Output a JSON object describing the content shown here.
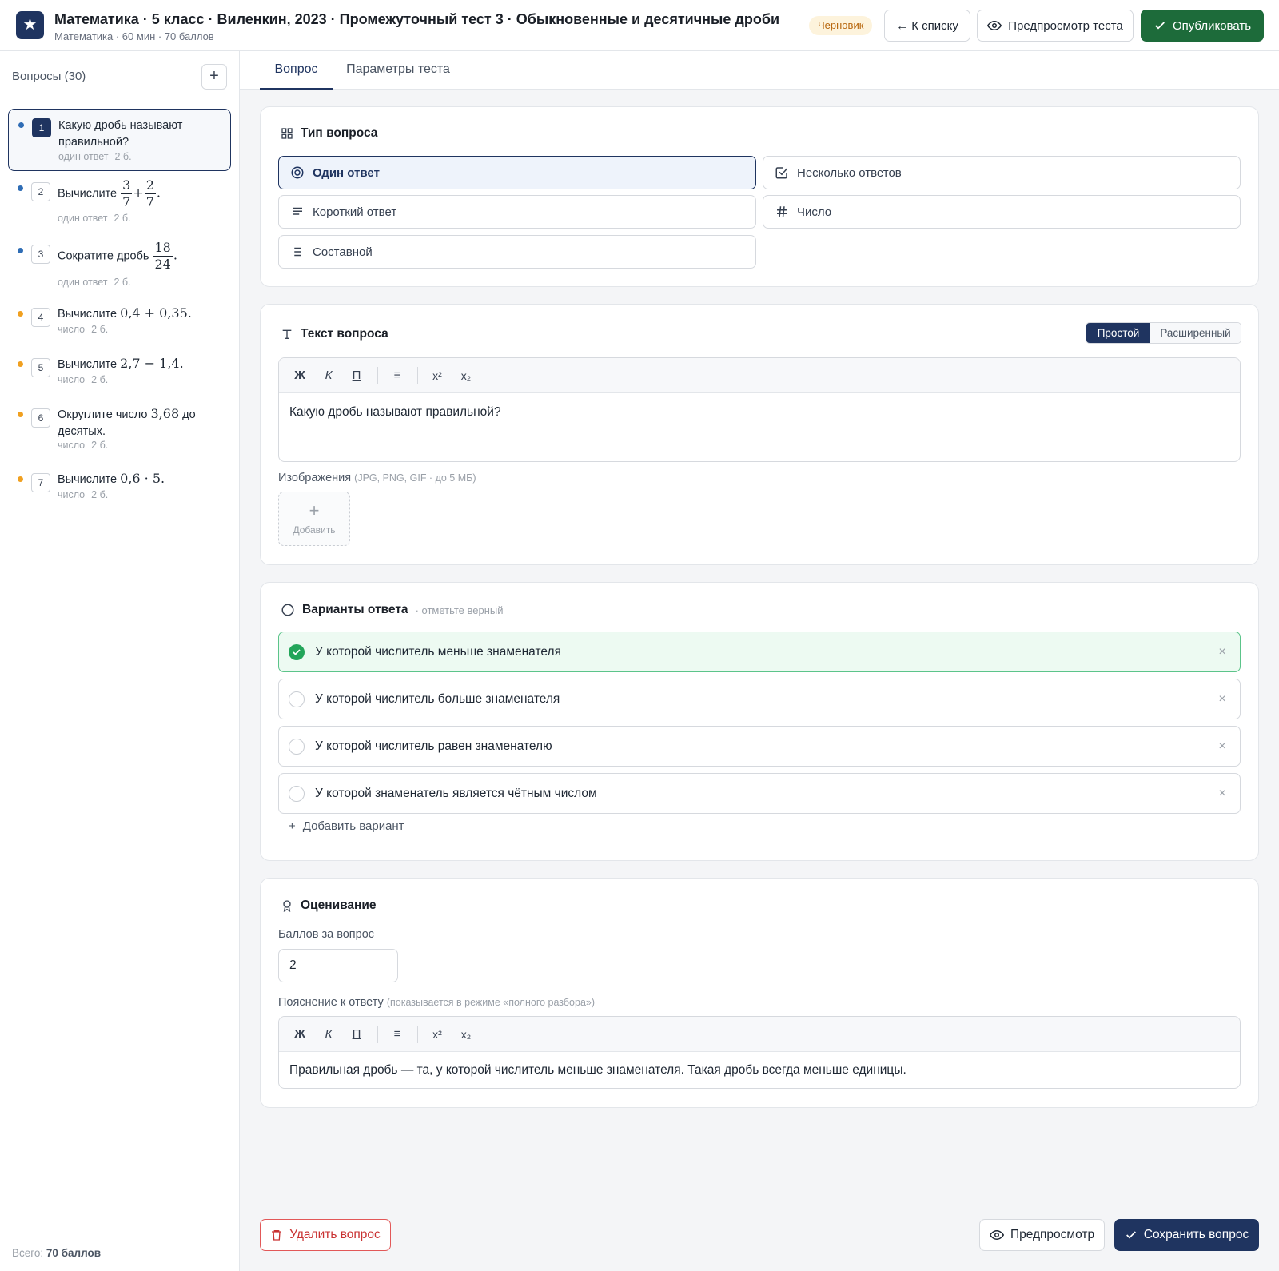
{
  "header": {
    "logo_glyph": "★",
    "title": "Математика · 5 класс · Виленкин, 2023 · Промежуточный тест 3 · Обыкновенные и десятичные дроби",
    "subtitle": "Математика · 60 мин · 70 баллов",
    "status_badge": "Черновик",
    "back_label": "← К списку",
    "preview_test_label": "Предпросмотр теста",
    "publish_label": "Опубликовать"
  },
  "sidebar": {
    "title": "Вопросы (30)",
    "add_label": "+",
    "total_prefix": "Всего:",
    "total_value": "70 баллов",
    "items": [
      {
        "num": "1",
        "text": "Какую дробь называют правильной?",
        "type": "один ответ",
        "points": "2 б.",
        "dot": "#2f6db5"
      },
      {
        "num": "2",
        "text_prefix": "Вычислите",
        "frac1": [
          "3",
          "7"
        ],
        "op": "+",
        "frac2": [
          "2",
          "7"
        ],
        "text_suffix": ".",
        "type": "один ответ",
        "points": "2 б.",
        "dot": "#2f6db5"
      },
      {
        "num": "3",
        "text_prefix": "Сократите дробь",
        "frac1": [
          "18",
          "24"
        ],
        "text_suffix": ".",
        "type": "один ответ",
        "points": "2 б.",
        "dot": "#2f6db5"
      },
      {
        "num": "4",
        "text_prefix": "Вычислите",
        "math": "0,4 + 0,35.",
        "type": "число",
        "points": "2 б.",
        "dot": "#f0a020"
      },
      {
        "num": "5",
        "text_prefix": "Вычислите",
        "math": "2,7 − 1,4.",
        "type": "число",
        "points": "2 б.",
        "dot": "#f0a020"
      },
      {
        "num": "6",
        "text_prefix": "Округлите число",
        "math": "3,68",
        "text_suffix": "до десятых.",
        "type": "число",
        "points": "2 б.",
        "dot": "#f0a020"
      },
      {
        "num": "7",
        "text_prefix": "Вычислите",
        "math": "0,6 · 5.",
        "type": "число",
        "points": "2 б.",
        "dot": "#f0a020"
      }
    ]
  },
  "tabs": {
    "question": "Вопрос",
    "params": "Параметры теста"
  },
  "question_type": {
    "title": "Тип вопроса",
    "options": {
      "single": "Один ответ",
      "multiple": "Несколько ответов",
      "short": "Короткий ответ",
      "number": "Число",
      "composite": "Составной"
    },
    "selected": "Один ответ"
  },
  "question_text": {
    "title": "Текст вопроса",
    "mode_simple": "Простой",
    "mode_extended": "Расширенный",
    "toolbar": {
      "bold": "Ж",
      "italic": "К",
      "underline": "П",
      "list": "≡",
      "sup": "x²",
      "sub": "x₂"
    },
    "body": "Какую дробь называют правильной?",
    "images_label": "Изображения",
    "images_hint": "(JPG, PNG, GIF · до 5 МБ)",
    "add_image_label": "Добавить"
  },
  "answers": {
    "title": "Варианты ответа",
    "hint": "· отметьте верный",
    "items": [
      {
        "text": "У которой числитель меньше знаменателя",
        "correct": true
      },
      {
        "text": "У которой числитель больше знаменателя",
        "correct": false
      },
      {
        "text": "У которой числитель равен знаменателю",
        "correct": false
      },
      {
        "text": "У которой знаменатель является чётным числом",
        "correct": false
      }
    ],
    "remove_glyph": "×",
    "add_variant_label": "Добавить вариант"
  },
  "grading": {
    "title": "Оценивание",
    "points_label": "Баллов за вопрос",
    "points_value": "2",
    "explanation_label": "Пояснение к ответу",
    "explanation_hint": "(показывается в режиме «полного разбора»)",
    "explanation_body": "Правильная дробь — та, у которой числитель меньше знаменателя. Такая дробь всегда меньше единицы."
  },
  "footer": {
    "delete_label": "Удалить вопрос",
    "preview_label": "Предпросмотр",
    "save_label": "Сохранить вопрос"
  },
  "colors": {
    "brand": "#1f3460",
    "publish": "#1d6b3a",
    "correct": "#23a55a",
    "danger": "#c93232",
    "draft_badge": "#b7650b"
  }
}
